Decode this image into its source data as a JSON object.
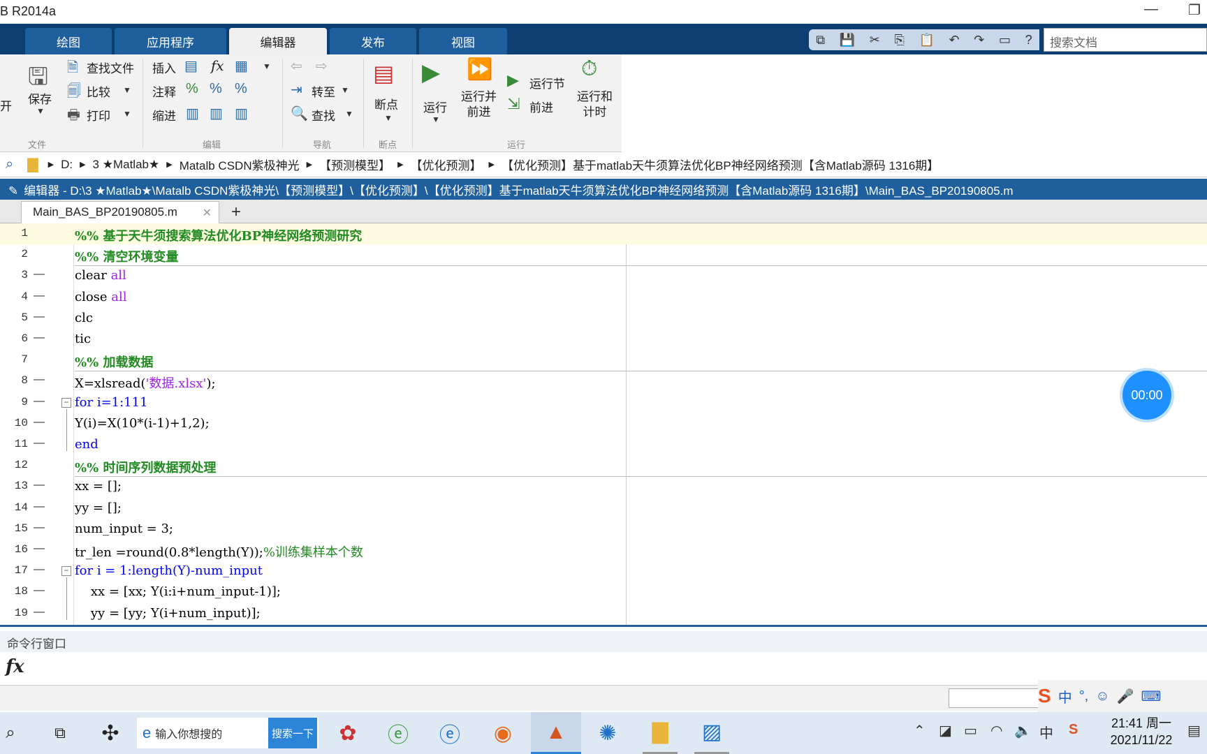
{
  "window": {
    "title": "B R2014a"
  },
  "tabs": [
    {
      "label": "绘图",
      "active": false
    },
    {
      "label": "应用程序",
      "active": false
    },
    {
      "label": "编辑器",
      "active": true
    },
    {
      "label": "发布",
      "active": false
    },
    {
      "label": "视图",
      "active": false
    }
  ],
  "search_docs": {
    "placeholder": "搜索文档"
  },
  "ribbon": {
    "file": {
      "open_label": "开",
      "save_label": "保存",
      "find_files": "查找文件",
      "compare": "比较",
      "print": "打印",
      "group": "文件"
    },
    "edit": {
      "insert": "插入",
      "comment": "注释",
      "indent": "缩进",
      "group": "编辑",
      "fx": "fx"
    },
    "navigate": {
      "goto": "转至",
      "find": "查找",
      "group": "导航"
    },
    "breakpoints": {
      "label": "断点",
      "group": "断点"
    },
    "run": {
      "run": "运行",
      "run_advance": "运行并\n前进",
      "run_section": "运行节",
      "advance": "前进",
      "run_time": "运行和\n计时",
      "group": "运行"
    }
  },
  "address": {
    "segments": [
      "D:",
      "3 ★Matlab★",
      "Matalb CSDN紫极神光",
      "【预测模型】",
      "【优化预测】",
      "【优化预测】基于matlab天牛须算法优化BP神经网络预测【含Matlab源码 1316期】"
    ]
  },
  "editor": {
    "header": "编辑器 - D:\\3 ★Matlab★\\Matalb CSDN紫极神光\\【预测模型】\\【优化预测】\\【优化预测】基于matlab天牛须算法优化BP神经网络预测【含Matlab源码 1316期】\\Main_BAS_BP20190805.m",
    "file_tab": "Main_BAS_BP20190805.m",
    "lines": [
      {
        "n": "1",
        "dash": "",
        "text": "%% 基于天牛须搜索算法优化BP神经网络预测研究"
      },
      {
        "n": "2",
        "dash": "",
        "text": "%% 清空环境变量"
      },
      {
        "n": "3",
        "dash": "—",
        "text": "clear all"
      },
      {
        "n": "4",
        "dash": "—",
        "text": "close all"
      },
      {
        "n": "5",
        "dash": "—",
        "text": "clc"
      },
      {
        "n": "6",
        "dash": "—",
        "text": "tic"
      },
      {
        "n": "7",
        "dash": "",
        "text": "%% 加载数据"
      },
      {
        "n": "8",
        "dash": "—",
        "text": "X=xlsread('数据.xlsx');"
      },
      {
        "n": "9",
        "dash": "—",
        "text": "for i=1:111"
      },
      {
        "n": "10",
        "dash": "—",
        "text": "Y(i)=X(10*(i-1)+1,2);"
      },
      {
        "n": "11",
        "dash": "—",
        "text": "end"
      },
      {
        "n": "12",
        "dash": "",
        "text": "%% 时间序列数据预处理"
      },
      {
        "n": "13",
        "dash": "—",
        "text": "xx = [];"
      },
      {
        "n": "14",
        "dash": "—",
        "text": "yy = [];"
      },
      {
        "n": "15",
        "dash": "—",
        "text": "num_input = 3;"
      },
      {
        "n": "16",
        "dash": "—",
        "text": "tr_len =round(0.8*length(Y));%训练集样本个数"
      },
      {
        "n": "17",
        "dash": "—",
        "text": "for i = 1:length(Y)-num_input"
      },
      {
        "n": "18",
        "dash": "—",
        "text": "    xx = [xx; Y(i:i+num_input-1)];"
      },
      {
        "n": "19",
        "dash": "—",
        "text": "    yy = [yy; Y(i+num_input)];"
      }
    ]
  },
  "timer": "00:00",
  "command_window": {
    "title": "命令行窗口",
    "prompt": "fx"
  },
  "ime": {
    "lang": "中"
  },
  "taskbar": {
    "search_placeholder": "输入你想搜的",
    "search_button": "搜索一下",
    "clock_time": "21:41 周一",
    "clock_date": "2021/11/22",
    "tray_lang": "中"
  },
  "colors": {
    "accent": "#1f5f9e",
    "tabbar": "#0e3f72",
    "comment": "#228b22",
    "keyword": "#0000ff",
    "string": "#a020f0"
  }
}
